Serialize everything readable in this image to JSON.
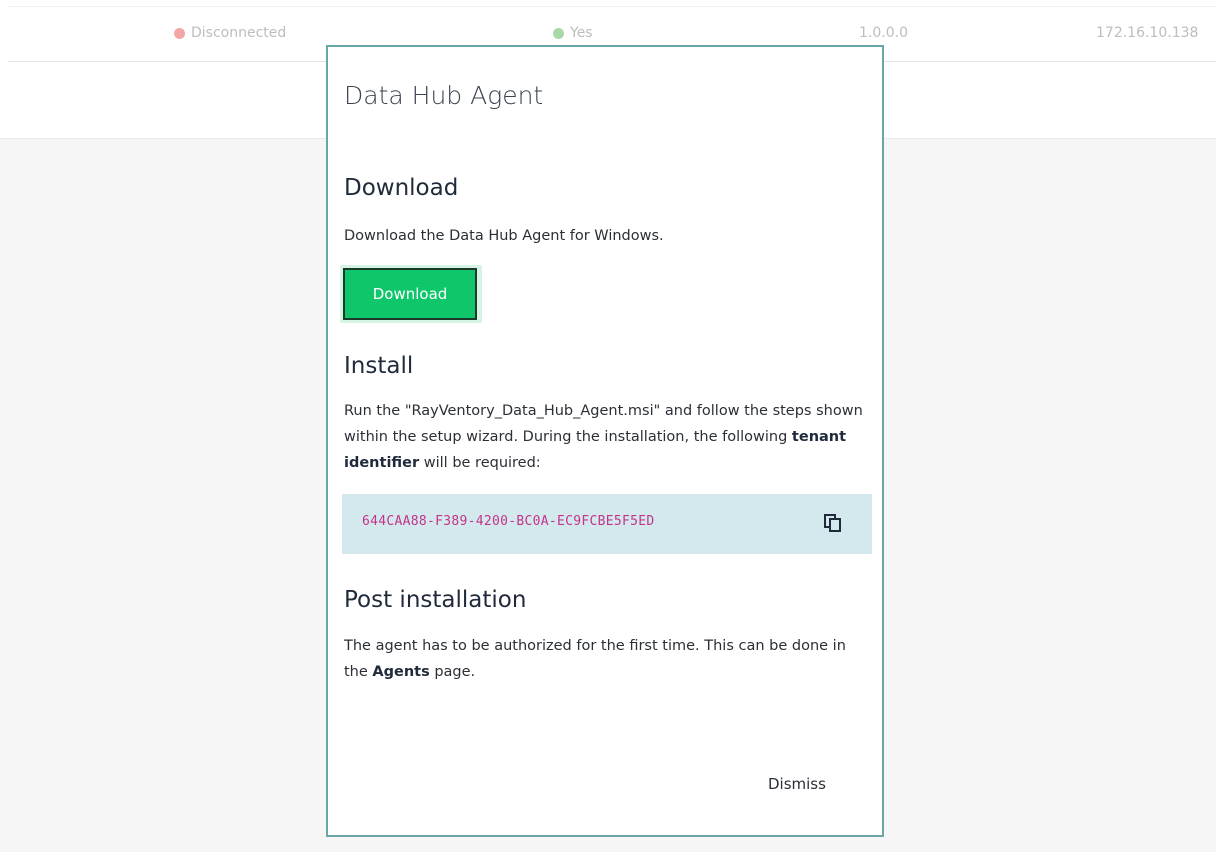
{
  "background_table": {
    "row": {
      "status": "Disconnected",
      "enabled": "Yes",
      "version": "1.0.0.0",
      "ip": "172.16.10.138"
    },
    "colors": {
      "status_dot": "#f4a6a6",
      "enabled_dot": "#a8d8a8"
    }
  },
  "modal": {
    "title": "Data Hub Agent",
    "download": {
      "heading": "Download",
      "text": "Download the Data Hub Agent for Windows.",
      "button_label": "Download"
    },
    "install": {
      "heading": "Install",
      "text_before": "Run the \"RayVentory_Data_Hub_Agent.msi\" and follow the steps shown within the setup wizard. During the installation, the following ",
      "bold": "tenant identifier",
      "text_after": " will be required:",
      "tenant_id": "644CAA88-F389-4200-BC0A-EC9FCBE5F5ED",
      "copy_icon": "copy-icon"
    },
    "post": {
      "heading": "Post installation",
      "text_before": "The agent has to be authorized for the first time. This can be done in the ",
      "bold": "Agents",
      "text_after": " page."
    },
    "dismiss_label": "Dismiss",
    "colors": {
      "border": "#6aa6a6",
      "download_button": "#0fc76a",
      "tenant_box": "#d4e9ee",
      "tenant_text": "#c2358a"
    }
  }
}
